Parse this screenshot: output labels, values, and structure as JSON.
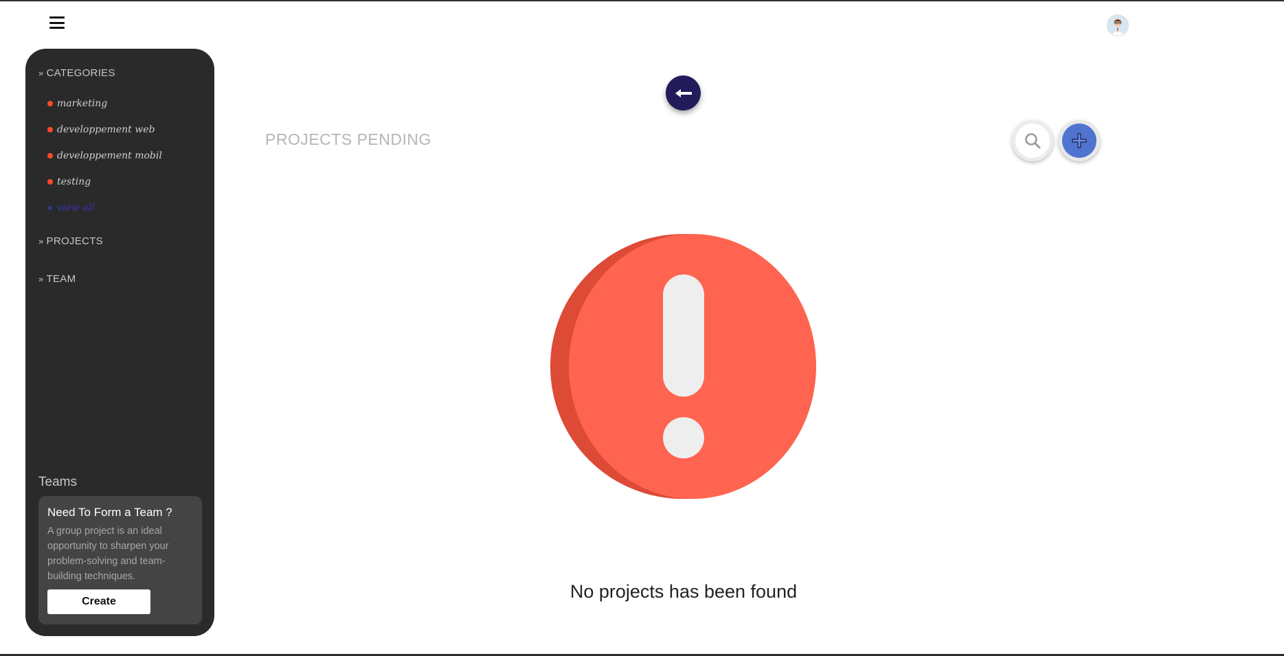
{
  "header": {
    "menu_icon": "hamburger-icon",
    "avatar_icon": "user-avatar"
  },
  "sidebar": {
    "categories_label": "CATEGORIES",
    "categories": [
      {
        "label": "marketing"
      },
      {
        "label": "developpement web"
      },
      {
        "label": "developpement mobil"
      },
      {
        "label": "testing"
      }
    ],
    "view_all_label": "view all",
    "projects_label": "PROJECTS",
    "team_label": "TEAM",
    "bullet_color": "#ff4a2a"
  },
  "teams": {
    "title": "Teams",
    "card_title": "Need To Form a Team ?",
    "card_text": "A group project is an ideal opportunity to sharpen your problem-solving and team-building techniques.",
    "create_label": "Create"
  },
  "main": {
    "back_icon": "arrow-left-icon",
    "title": "PROJECTS PENDING",
    "search_icon": "search-icon",
    "add_icon": "plus-icon",
    "empty_icon": "exclamation-circle-icon",
    "empty_message": "No projects has been found",
    "alert_color": "#fe6450"
  }
}
